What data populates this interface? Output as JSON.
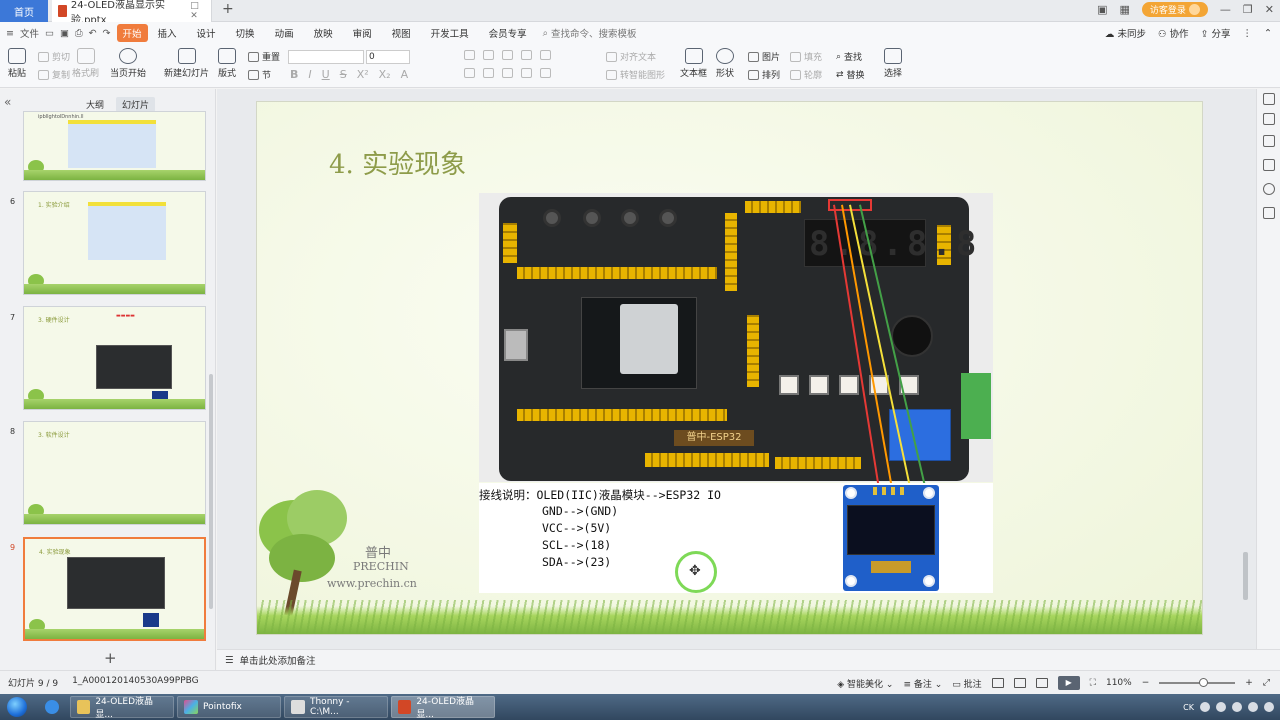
{
  "tabs": {
    "home": "首页",
    "document": "24-OLED液晶显示实验.pptx",
    "guest_login": "访客登录"
  },
  "menu": {
    "file": "文件",
    "items": [
      "开始",
      "插入",
      "设计",
      "切换",
      "动画",
      "放映",
      "审阅",
      "视图",
      "开发工具",
      "会员专享"
    ],
    "search_placeholder": "查找命令、搜索模板",
    "unsynced": "未同步",
    "collaborate": "协作",
    "share": "分享"
  },
  "ribbon": {
    "paste": "粘贴",
    "cut": "剪切",
    "copy": "复制",
    "format_painter": "格式刷",
    "from_current": "当页开始",
    "new_slide": "新建幻灯片",
    "layout": "版式",
    "section": "节",
    "reset": "重置",
    "font_size": "0",
    "align_text": "对齐文本",
    "convert_smartart": "转智能图形",
    "textbox": "文本框",
    "shape": "形状",
    "picture": "图片",
    "fill": "填充",
    "arrange": "排列",
    "outline": "轮廓",
    "find": "查找",
    "replace": "替换",
    "select": "选择"
  },
  "left_panel": {
    "tab_outline": "大纲",
    "tab_slides": "幻灯片",
    "slides": [
      {
        "num": "6",
        "title": "1. 实验介绍"
      },
      {
        "num": "7",
        "title": "3. 硬件设计"
      },
      {
        "num": "8",
        "title": "3. 软件设计"
      },
      {
        "num": "9",
        "title": "4. 实验现象"
      }
    ],
    "first_thumb_text": "ipbllghtolDnnhin.ll"
  },
  "slide": {
    "title": "4. 实验现象",
    "board_label": "普中-ESP32",
    "seg_digits": "8.8.8.8",
    "wiring": {
      "line1": "接线说明：OLED(IIC)液晶模块-->ESP32 IO",
      "line2": "GND-->(GND)",
      "line3": "VCC-->(5V)",
      "line4": "SCL-->(18)",
      "line5": "SDA-->(23)"
    },
    "logo_cn": "普中",
    "logo_en": "PRECHIN",
    "logo_url": "www.prechin.cn"
  },
  "notes_placeholder": "单击此处添加备注",
  "status": {
    "slide_info": "幻灯片 9 / 9",
    "file_id": "1_A000120140530A99PPBG",
    "smart_beautify": "智能美化",
    "notes": "备注",
    "comments": "批注",
    "zoom": "110%",
    "zoom_fraction": 0.58
  },
  "taskbar": {
    "items": [
      "24-OLED液晶显...",
      "Pointofix",
      "Thonny - C:\\M...",
      "24-OLED液晶显..."
    ],
    "tray_text": "CK"
  },
  "colors": {
    "accent_orange": "#f07c3d",
    "title_green": "#8e9c4a",
    "home_blue": "#3c78d8"
  }
}
